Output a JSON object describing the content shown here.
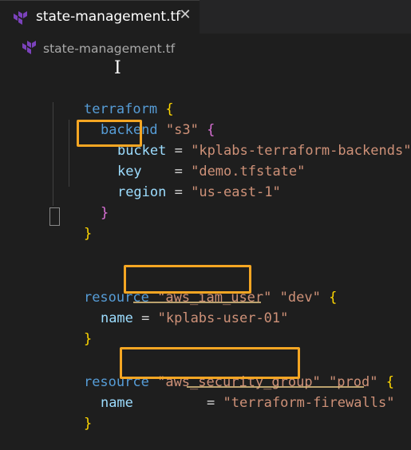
{
  "tab": {
    "title": "state-management.tf",
    "close_glyph": "✕",
    "icon": "terraform-icon"
  },
  "breadcrumb": {
    "file": "state-management.tf",
    "icon": "terraform-icon"
  },
  "code": {
    "terraform": {
      "keyword": "terraform",
      "open_brace": "{",
      "backend_keyword": "backend",
      "backend_type": "\"s3\"",
      "backend_open": "{",
      "bucket_key": "bucket",
      "bucket_eq": " = ",
      "bucket_value": "\"kplabs-terraform-backends\"",
      "key_key": "key",
      "key_eq": "    = ",
      "key_value": "\"demo.tfstate\"",
      "region_key": "region",
      "region_eq": " = ",
      "region_value": "\"us-east-1\"",
      "backend_close": "}",
      "close_brace": "}"
    },
    "iam_user": {
      "keyword": "resource",
      "type": "\"aws_iam_user\"",
      "name": "\"dev\"",
      "open_brace": "{",
      "attr_key": "name",
      "attr_eq": " = ",
      "attr_value": "\"kplabs-user-01\"",
      "close_brace": "}"
    },
    "security_group": {
      "keyword": "resource",
      "type": "\"aws_security_group\"",
      "name": "\"prod\"",
      "open_brace": "{",
      "attr_key": "name",
      "attr_eq": "         = ",
      "attr_value": "\"terraform-firewalls\"",
      "close_brace": "}"
    }
  },
  "colors": {
    "highlight_box": "#f5a623",
    "keyword": "#569cd6",
    "string": "#ce9178",
    "attribute": "#9cdcfe"
  }
}
